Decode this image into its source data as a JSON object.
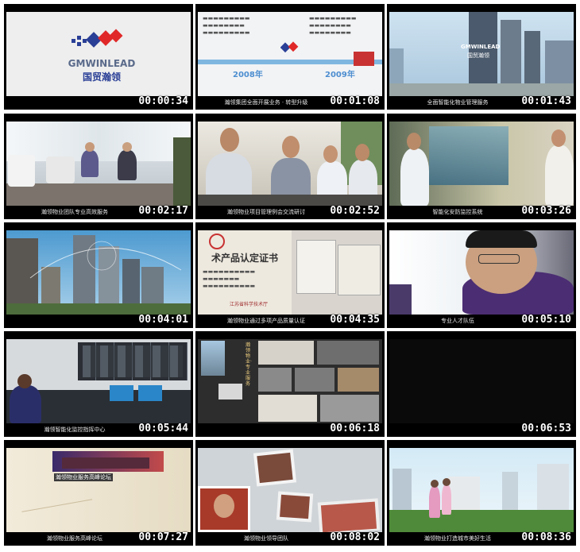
{
  "logo": {
    "text_en": "GMWINLEAD",
    "text_cn": "国贸瀚领"
  },
  "tiles": [
    {
      "timestamp": "00:00:34",
      "caption": ""
    },
    {
      "timestamp": "00:01:08",
      "caption": "瀚领集团全面开展业务 · 转型升级"
    },
    {
      "timestamp": "00:01:43",
      "caption": "全面智能化物业管理服务"
    },
    {
      "timestamp": "00:02:17",
      "caption": "瀚领物业团队专业高效服务"
    },
    {
      "timestamp": "00:02:52",
      "caption": "瀚领物业项目管理例会交流研讨"
    },
    {
      "timestamp": "00:03:26",
      "caption": "智能化安防监控系统"
    },
    {
      "timestamp": "00:04:01",
      "caption": ""
    },
    {
      "timestamp": "00:04:35",
      "caption": "瀚领物业通过多项产品质量认证"
    },
    {
      "timestamp": "00:05:10",
      "caption": "专业人才队伍"
    },
    {
      "timestamp": "00:05:44",
      "caption": "瀚领智能化监控指挥中心"
    },
    {
      "timestamp": "00:06:18",
      "caption": ""
    },
    {
      "timestamp": "00:06:53",
      "caption": ""
    },
    {
      "timestamp": "00:07:27",
      "caption": "瀚领物业服务高峰论坛"
    },
    {
      "timestamp": "00:08:02",
      "caption": "瀚领物业领导团队"
    },
    {
      "timestamp": "00:08:36",
      "caption": "瀚领物业打造城市美好生活"
    }
  ],
  "overlays": {
    "year_left": "2008年",
    "year_right": "2009年",
    "cert_title": "术产品认定证书",
    "cert_stamp": "江苏省科学技术厅",
    "vertical_text": "瀚领物业·专业服务",
    "forum_banner": "瀚领物业服务高峰论坛"
  }
}
